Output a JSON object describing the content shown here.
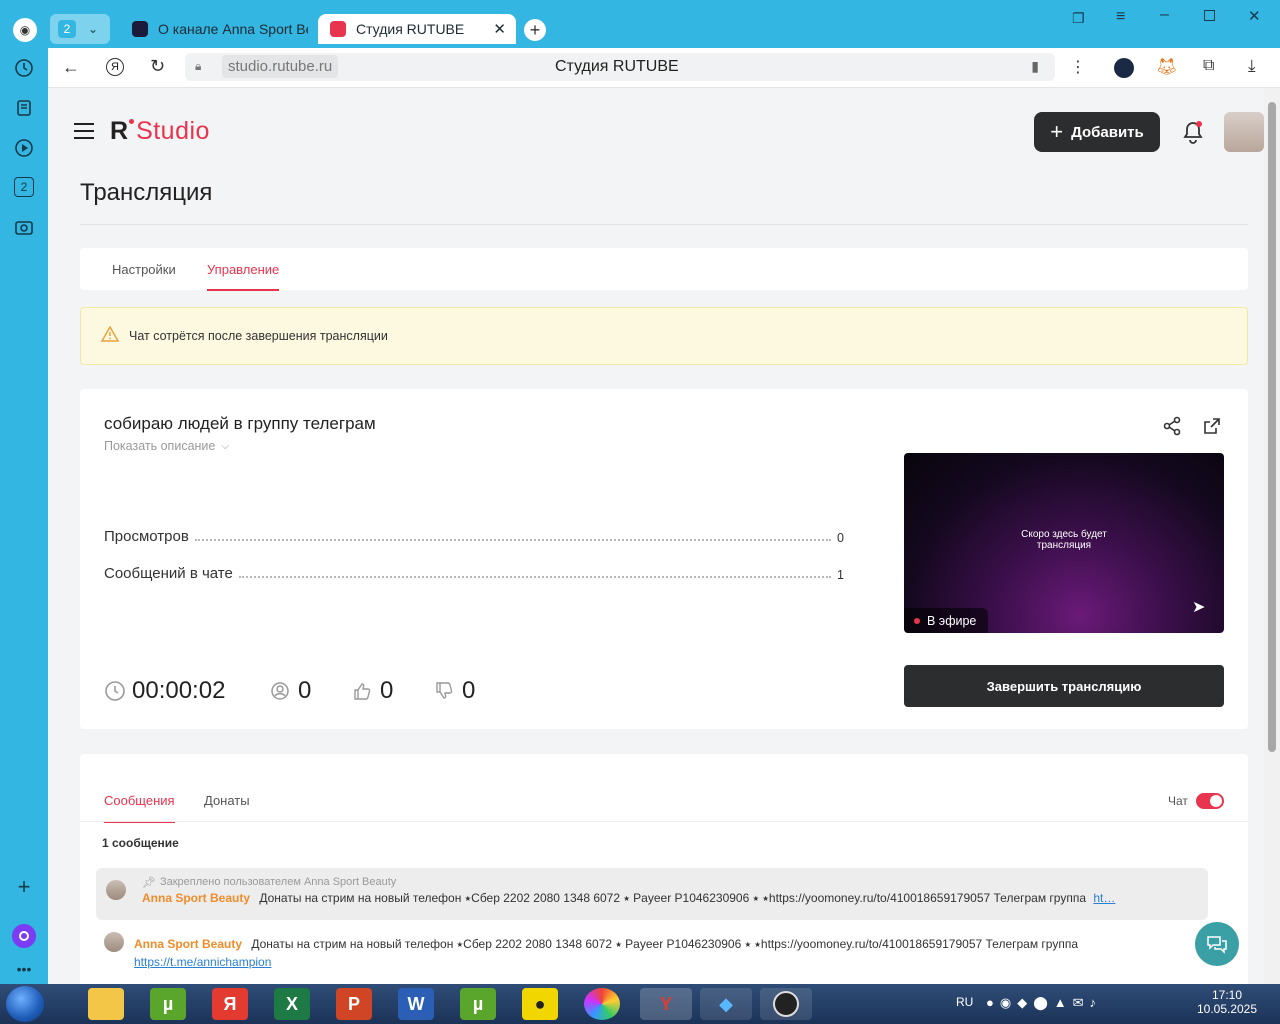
{
  "browser": {
    "tab_counter": "2",
    "tabs": [
      {
        "title": "О канале Anna Sport Beauty"
      },
      {
        "title": "Студия RUTUBE"
      }
    ],
    "url": "studio.rutube.ru",
    "page_title": "Студия RUTUBE"
  },
  "sidebar": {
    "counter": "2"
  },
  "header": {
    "logo_r": "R",
    "logo_text": "Studio",
    "add_button": "Добавить"
  },
  "page": {
    "title": "Трансляция"
  },
  "tabs": {
    "settings": "Настройки",
    "manage": "Управление"
  },
  "warning": {
    "text": "Чат сотрётся после завершения трансляции"
  },
  "stream": {
    "title": "собираю людей в группу телеграм",
    "show_description": "Показать описание",
    "views_label": "Просмотров",
    "views_value": "0",
    "messages_label": "Сообщений в чате",
    "messages_value": "1",
    "timer": "00:00:02",
    "viewers": "0",
    "likes": "0",
    "dislikes": "0",
    "preview_text_1": "Скоро здесь будет",
    "preview_text_2": "трансляция",
    "live_badge": "В эфире",
    "end_button": "Завершить трансляцию"
  },
  "chat": {
    "tab_messages": "Сообщения",
    "tab_donates": "Донаты",
    "toggle_label": "Чат",
    "toggle_on": true,
    "count_label": "1 сообщение",
    "pinned_note": "Закреплено пользователем Anna Sport Beauty",
    "pinned_author": "Anna Sport Beauty",
    "pinned_text": "Донаты на стрим на новый телефон ⭑Сбер 2202 2080 1348 6072 ⭑ Payeer P1046230906 ⭑ ⭑https://yoomoney.ru/to/410018659179057 Телеграм группа",
    "pinned_link": "ht…",
    "message_author": "Anna Sport Beauty",
    "message_text": "Донаты на стрим на новый телефон ⭑Сбер 2202 2080 1348 6072 ⭑ Payeer P1046230906 ⭑ ⭑https://yoomoney.ru/to/410018659179057 Телеграм группа",
    "message_link": "https://t.me/annichampion"
  },
  "taskbar": {
    "lang": "RU",
    "time": "17:10",
    "date": "10.05.2025"
  },
  "colors": {
    "accent": "#e8344e",
    "dark": "#2c2d2f",
    "warning_bg": "#fdf9e0"
  }
}
